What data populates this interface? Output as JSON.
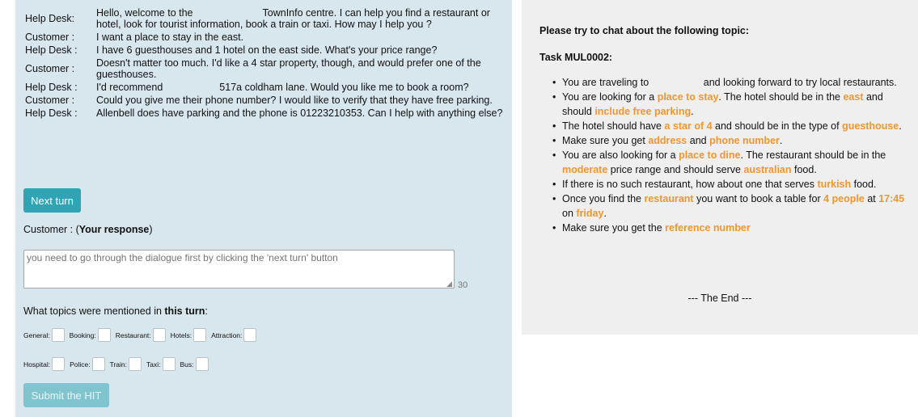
{
  "dialogue": [
    {
      "speaker": "Help Desk:",
      "text_a": "Hello, welcome to the",
      "text_b": "TownInfo centre. I can help you find a restaurant or hotel, look for tourist information, book a train or taxi. How may I help you ?"
    },
    {
      "speaker": "Customer :",
      "text_a": "I want a place to stay in the east.",
      "text_b": ""
    },
    {
      "speaker": "Help Desk :",
      "text_a": "I have 6 guesthouses and 1 hotel on the east side. What's your price range?",
      "text_b": ""
    },
    {
      "speaker": "Customer :",
      "text_a": "Doesn't matter too much. I'd like a 4 star property, though, and would prefer one of the guesthouses.",
      "text_b": ""
    },
    {
      "speaker": "Help Desk :",
      "text_a": "I'd recommend",
      "text_b": "517a coldham lane. Would you like me to book a room?"
    },
    {
      "speaker": "Customer :",
      "text_a": "Could you give me their phone number? I would like to verify that they have free parking.",
      "text_b": ""
    },
    {
      "speaker": "Help Desk :",
      "text_a": "Allenbell does have parking and the phone is 01223210353. Can I help with anything else?",
      "text_b": ""
    }
  ],
  "next_turn_label": "Next turn",
  "response": {
    "prefix": "Customer : (",
    "bold": "Your response",
    "suffix": ")",
    "placeholder": "you need to go through the dialogue first by clicking the 'next turn' button",
    "char_count": "30"
  },
  "topics": {
    "prefix": "What topics were mentioned in ",
    "bold": "this turn",
    "suffix": ":",
    "row1": [
      "General:",
      "Booking:",
      "Restaurant:",
      "Hotels:",
      "Attraction:"
    ],
    "row2": [
      "Hospital:",
      "Police:",
      "Train:",
      "Taxi:",
      "Bus:"
    ]
  },
  "submit_label": "Submit the HIT",
  "task": {
    "heading": "Please try to chat about the following topic:",
    "id": "Task MUL0002:",
    "goals": [
      [
        {
          "t": "You are traveling to"
        },
        {
          "gap": true
        },
        {
          "t": " and looking forward to try local restaurants."
        }
      ],
      [
        {
          "t": "You are looking for a "
        },
        {
          "h": "place to stay"
        },
        {
          "t": ". The hotel should be in the "
        },
        {
          "h": "east"
        },
        {
          "t": " and should "
        },
        {
          "h": "include free parking"
        },
        {
          "t": "."
        }
      ],
      [
        {
          "t": "The hotel should have "
        },
        {
          "h": "a star of 4"
        },
        {
          "t": " and should be in the type of "
        },
        {
          "h": "guesthouse"
        },
        {
          "t": "."
        }
      ],
      [
        {
          "t": "Make sure you get "
        },
        {
          "h": "address"
        },
        {
          "t": " and "
        },
        {
          "h": "phone number"
        },
        {
          "t": "."
        }
      ],
      [
        {
          "t": "You are also looking for a "
        },
        {
          "h": "place to dine"
        },
        {
          "t": ". The restaurant should be in the "
        },
        {
          "h": "moderate"
        },
        {
          "t": " price range and should serve "
        },
        {
          "h": "australian"
        },
        {
          "t": " food."
        }
      ],
      [
        {
          "t": "If there is no such restaurant, how about one that serves "
        },
        {
          "h": "turkish"
        },
        {
          "t": " food."
        }
      ],
      [
        {
          "t": "Once you find the "
        },
        {
          "h": "restaurant"
        },
        {
          "t": " you want to book a table for "
        },
        {
          "h": "4 people"
        },
        {
          "t": " at "
        },
        {
          "h": "17:45"
        },
        {
          "t": " on "
        },
        {
          "h": "friday"
        },
        {
          "t": "."
        }
      ],
      [
        {
          "t": "Make sure you get the "
        },
        {
          "h": "reference number"
        }
      ]
    ],
    "end": "--- The End ---"
  },
  "colors": {
    "highlight": "#f0962f",
    "left_bg": "#d8e6ed",
    "right_bg": "#efefef",
    "button": "#2fa4b5",
    "button_disabled": "#7fc4cf"
  }
}
